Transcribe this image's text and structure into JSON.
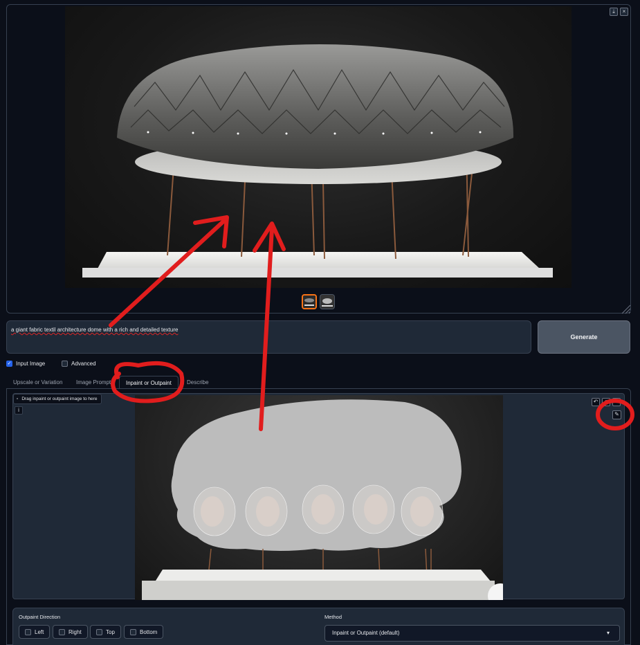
{
  "gallery": {
    "download_icon": "download-icon",
    "close_icon": "close-icon",
    "main_image_alt": "Generated fabric dome architecture model"
  },
  "prompt": {
    "value": "a giant fabric textil architecture dome with a rich and detailed texture"
  },
  "generate_label": "Generate",
  "options": {
    "input_image_label": "Input Image",
    "input_image_checked": true,
    "advanced_label": "Advanced",
    "advanced_checked": false
  },
  "tabs": [
    {
      "label": "Upscale or Variation",
      "active": false
    },
    {
      "label": "Image Prompt",
      "active": false
    },
    {
      "label": "Inpaint or Outpaint",
      "active": true
    },
    {
      "label": "Describe",
      "active": false
    }
  ],
  "editor": {
    "drop_label": "Drag inpaint or outpaint image to here",
    "info_icon_text": "i"
  },
  "outpaint": {
    "title": "Outpaint Direction",
    "directions": [
      "Left",
      "Right",
      "Top",
      "Bottom"
    ]
  },
  "method": {
    "title": "Method",
    "selected": "Inpaint or Outpaint (default)"
  },
  "annotation_color": "#e11d1d",
  "accent_color": "#f97316"
}
